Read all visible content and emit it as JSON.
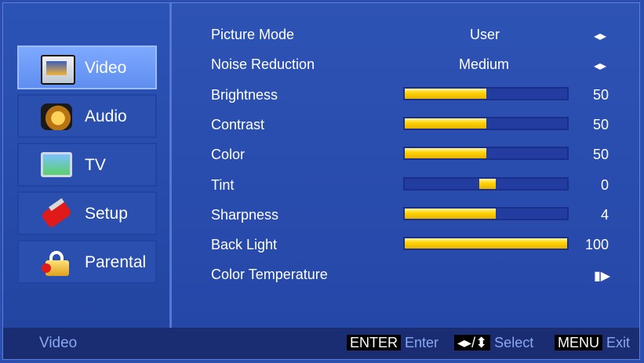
{
  "nav": [
    {
      "label": "Video",
      "icon": "film-icon",
      "active": true
    },
    {
      "label": "Audio",
      "icon": "speaker-icon",
      "active": false
    },
    {
      "label": "TV",
      "icon": "tv-icon",
      "active": false
    },
    {
      "label": "Setup",
      "icon": "tools-icon",
      "active": false
    },
    {
      "label": "Parental",
      "icon": "lock-icon",
      "active": false
    }
  ],
  "settings": [
    {
      "label": "Picture Mode",
      "value": "User",
      "control": "arrows"
    },
    {
      "label": "Noise Reduction",
      "value": "Medium",
      "control": "arrows"
    },
    {
      "label": "Brightness",
      "value": "50",
      "control": "bar",
      "level": 0.5
    },
    {
      "label": "Contrast",
      "value": "50",
      "control": "bar",
      "level": 0.5
    },
    {
      "label": "Color",
      "value": "50",
      "control": "bar",
      "level": 0.5
    },
    {
      "label": "Tint",
      "value": "0",
      "control": "bar",
      "level": 0.5
    },
    {
      "label": "Sharpness",
      "value": "4",
      "control": "bar",
      "level": 0.56
    },
    {
      "label": "Back Light",
      "value": "100",
      "control": "bar",
      "level": 1.0
    },
    {
      "label": "Color Temperature",
      "value": "",
      "control": "enter"
    }
  ],
  "footer": {
    "title": "Video",
    "enter_key": "ENTER",
    "enter_label": "Enter",
    "select_key": "◂▸/⬍",
    "select_label": "Select",
    "menu_key": "MENU",
    "menu_label": "Exit"
  },
  "colors": {
    "accent": "#ffd100",
    "background": "#2a4fb0"
  }
}
